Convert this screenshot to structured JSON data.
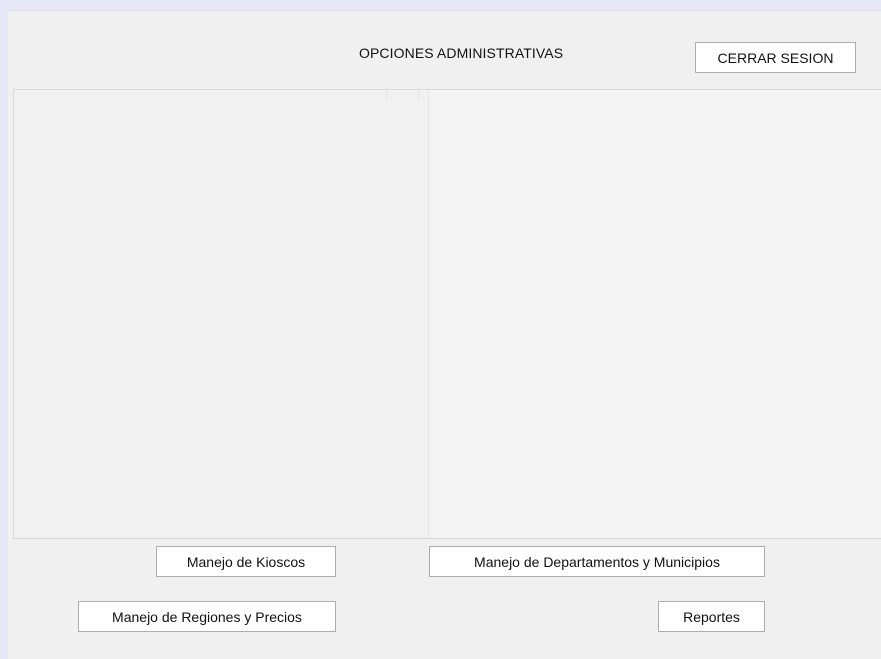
{
  "header": {
    "title": "OPCIONES ADMINISTRATIVAS",
    "logout_label": "CERRAR SESION"
  },
  "actions": {
    "kioscos_label": "Manejo de Kioscos",
    "departamentos_label": "Manejo de Departamentos y Municipios",
    "regiones_label": "Manejo de Regiones y Precios",
    "reportes_label": "Reportes"
  },
  "colors": {
    "window_bg": "#f0f0f0",
    "outer_bg": "#e6e6f7",
    "button_bg": "#ffffff",
    "button_border": "#adadad"
  }
}
